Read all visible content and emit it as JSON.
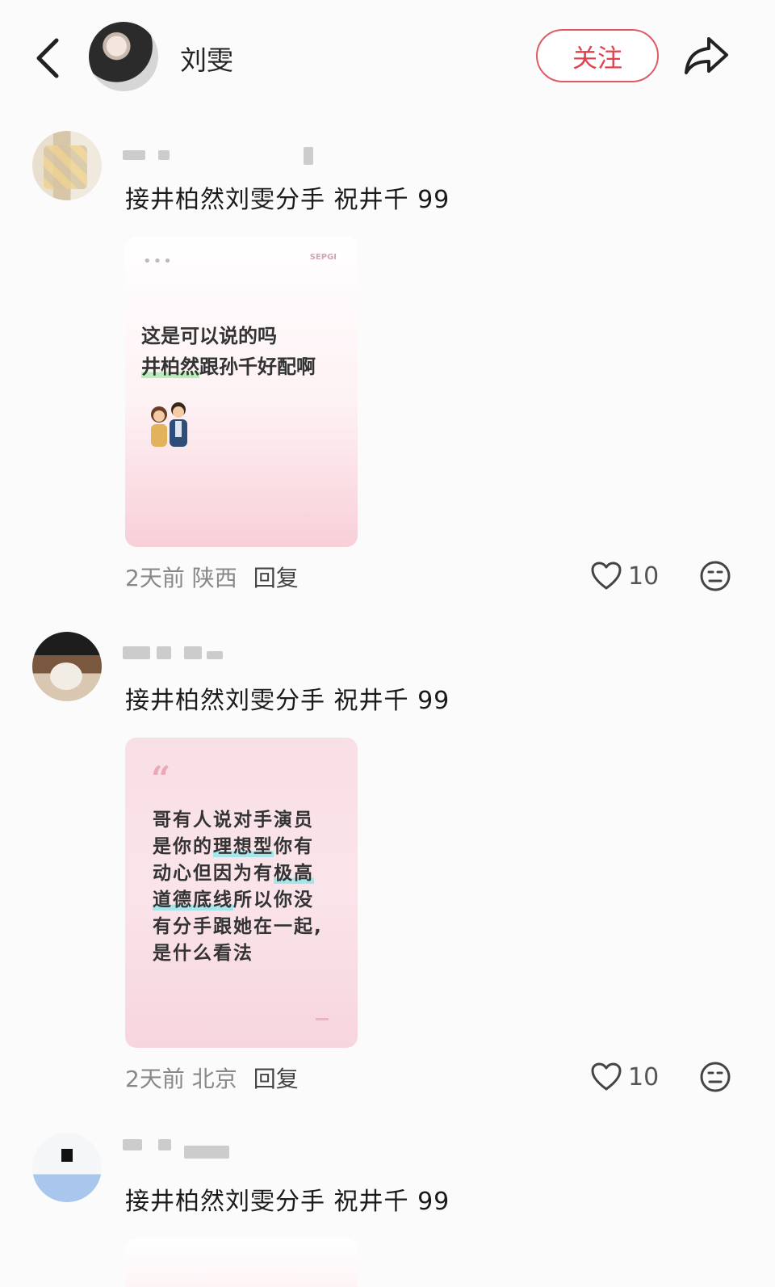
{
  "header": {
    "username": "刘雯",
    "follow_label": "关注",
    "icons": {
      "back": "chevron-left-icon",
      "share": "share-arrow-icon"
    }
  },
  "comments": [
    {
      "text": "接井柏然刘雯分手 祝井千 99",
      "image": {
        "brand": "SEPGI",
        "line1": "这是可以说的吗",
        "line2_highlight": "井柏然",
        "line2_rest": "跟孙千好配啊"
      },
      "time": "2天前",
      "location": "陕西",
      "reply_label": "回复",
      "likes": "10"
    },
    {
      "text": "接井柏然刘雯分手 祝井千 99",
      "image": {
        "quote": "“",
        "l1": "哥有人说对手演员",
        "l2a": "是你的",
        "l2hl": "理想型",
        "l2b": "你有",
        "l3a": "动心但因为有",
        "l3hl": "极高",
        "l4hl": "道德底线",
        "l4b": "所以你没",
        "l5": "有分手跟她在一起,",
        "l6": "是什么看法"
      },
      "time": "2天前",
      "location": "北京",
      "reply_label": "回复",
      "likes": "10"
    },
    {
      "text": "接井柏然刘雯分手 祝井千 99"
    }
  ],
  "colors": {
    "accent": "#e0414d",
    "background": "#fbfbfb"
  }
}
